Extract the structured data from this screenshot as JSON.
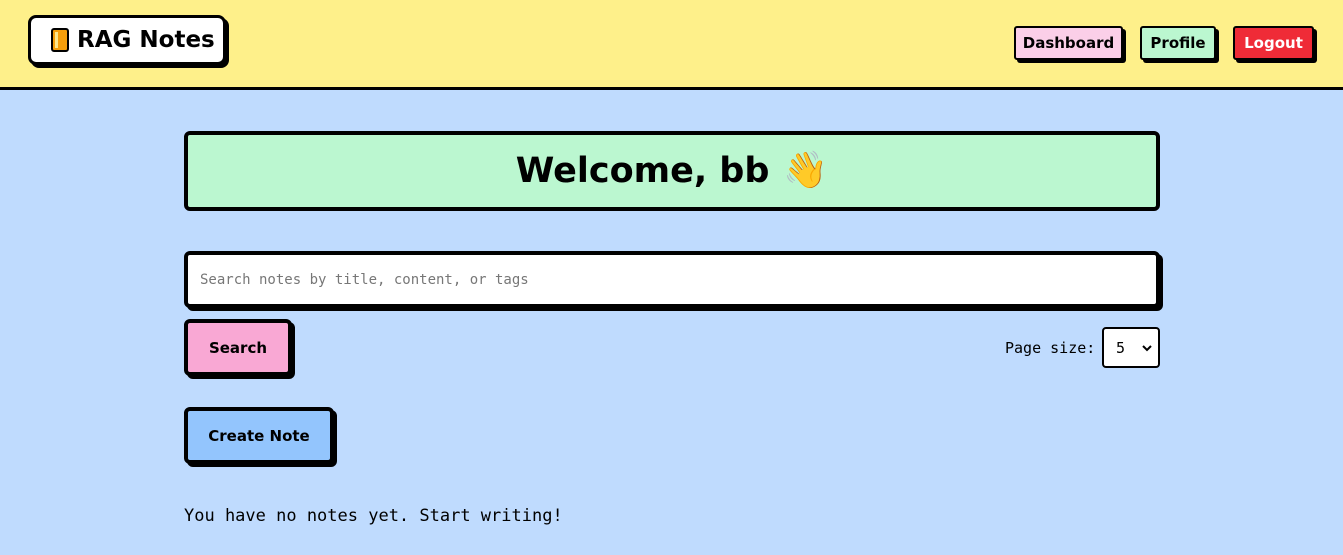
{
  "header": {
    "brand": "RAG Notes",
    "brand_icon": "notebook-icon",
    "nav": {
      "dashboard": "Dashboard",
      "profile": "Profile",
      "logout": "Logout"
    }
  },
  "welcome": {
    "text": "Welcome, bb",
    "icon": "waving-hand-icon",
    "emoji": "👋"
  },
  "search": {
    "placeholder": "Search notes by title, content, or tags",
    "value": "",
    "button_label": "Search"
  },
  "page_size": {
    "label": "Page size:",
    "selected": "5"
  },
  "actions": {
    "create_label": "Create Note"
  },
  "notes": {
    "empty_message": "You have no notes yet. Start writing!"
  },
  "colors": {
    "header_bg": "#fef08a",
    "page_bg": "#bfdbfe",
    "welcome_bg": "#bbf7d0",
    "dashboard_bg": "#fbcfe8",
    "profile_bg": "#bbf7d0",
    "logout_bg": "#ef2b37",
    "search_btn_bg": "#f9a8d4",
    "create_btn_bg": "#93c5fd"
  }
}
